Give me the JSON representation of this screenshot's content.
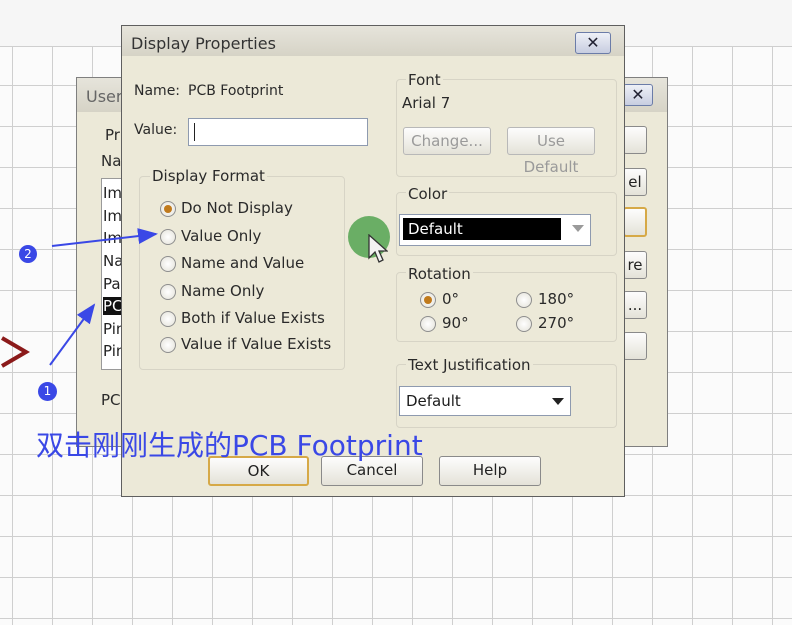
{
  "back_dialog": {
    "title": "User",
    "group_label": "Pr",
    "name_label": "Na",
    "list_items": [
      "Im",
      "Im",
      "Im",
      "Na",
      "Pa",
      "PC",
      "Pin",
      "Pin"
    ],
    "bottom_text": "PC",
    "side_buttons": [
      "",
      "el",
      "",
      "re",
      "...",
      ""
    ]
  },
  "dialog": {
    "title": "Display Properties",
    "close_glyph": "✕",
    "name_label": "Name:",
    "name_value": "PCB Footprint",
    "value_label": "Value:",
    "value_input": "",
    "display_format": {
      "label": "Display Format",
      "options": [
        "Do Not Display",
        "Value Only",
        "Name and Value",
        "Name Only",
        "Both if Value Exists",
        "Value if Value Exists"
      ],
      "selected": "Do Not Display"
    },
    "font": {
      "label": "Font",
      "value": "Arial 7",
      "change_button": "Change...",
      "default_button": "Use Default"
    },
    "color": {
      "label": "Color",
      "value": "Default"
    },
    "rotation": {
      "label": "Rotation",
      "options": [
        "0°",
        "180°",
        "90°",
        "270°"
      ],
      "selected": "0°"
    },
    "justification": {
      "label": "Text Justification",
      "value": "Default"
    },
    "buttons": {
      "ok": "OK",
      "cancel": "Cancel",
      "help": "Help"
    }
  },
  "annotations": {
    "caption": "双击刚刚生成的PCB Footprint",
    "marker1": "1",
    "marker2": "2"
  },
  "colors": {
    "annotation": "#3a48e6",
    "dialog_bg": "#ece9d8",
    "cursor_highlight": "#3f9a3f",
    "radio_selected": "#c07a1c"
  }
}
